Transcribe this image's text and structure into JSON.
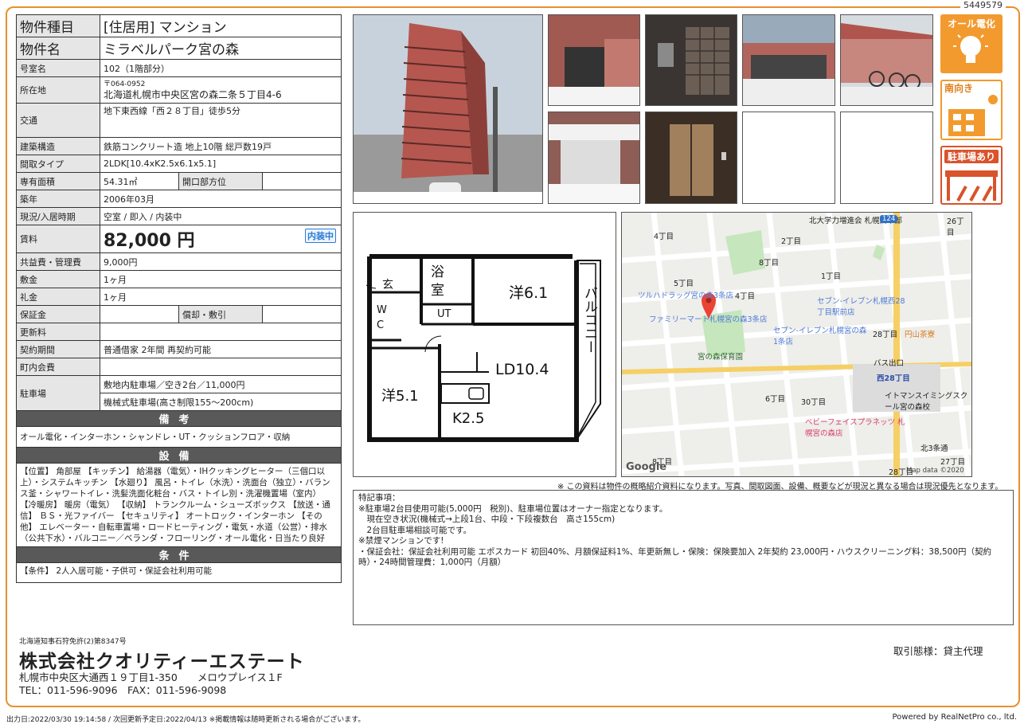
{
  "doc_id": "5449579",
  "spec": {
    "type_label": "物件種目",
    "type_value": "[住居用] マンション",
    "name_label": "物件名",
    "name_value": "ミラベルパーク宮の森",
    "room_label": "号室名",
    "room_value": "102（1階部分）",
    "addr_label": "所在地",
    "zip": "〒064-0952",
    "addr_value": "北海道札幌市中央区宮の森二条５丁目4-6",
    "access_label": "交通",
    "access_value": "地下東西線「西２８丁目」徒歩5分",
    "structure_label": "建築構造",
    "structure_value": "鉄筋コンクリート造 地上10階 総戸数19戸",
    "layout_label": "間取タイプ",
    "layout_value": "2LDK[10.4xK2.5x6.1x5.1]",
    "area_label": "専有面積",
    "area_value": "54.31㎡",
    "window_label": "開口部方位",
    "window_value": "",
    "built_label": "築年",
    "built_value": "2006年03月",
    "status_label": "現況/入居時期",
    "status_value": "空室 / 即入 / 内装中",
    "rent_label": "賃料",
    "rent_value": "82,000 円",
    "rent_badge": "内装中",
    "fee_label": "共益費・管理費",
    "fee_value": "9,000円",
    "deposit_label": "敷金",
    "deposit_value": "1ヶ月",
    "key_label": "礼金",
    "key_value": "1ヶ月",
    "guarantee_label": "保証金",
    "guarantee_value": "",
    "amort_label": "償却・敷引",
    "amort_value": "",
    "renew_label": "更新料",
    "renew_value": "",
    "contract_label": "契約期間",
    "contract_value": "普通借家 2年間 再契約可能",
    "town_label": "町内会費",
    "town_value": "",
    "parking_label": "駐車場",
    "parking_value1": "敷地内駐車場／空き2台／11,000円",
    "parking_value2": "機械式駐車場(高さ制限155～200cm)",
    "biko_head": "備考",
    "biko_text": "オール電化・インターホン・シャンドレ・UT・クッションフロア・収納",
    "setsubi_head": "設備",
    "setsubi_text": "【位置】 角部屋 【キッチン】 給湯器（電気）・IHクッキングヒーター（三個口以上）・システムキッチン 【水廻り】 風呂・トイレ（水洗）・洗面台（独立）・バランス釜・シャワートイレ・洗髪洗面化粧台・バス・トイレ別・洗濯機置場（室内） 【冷暖房】 暖房（電気） 【収納】 トランクルーム・シューズボックス 【放送・通信】 ＢＳ・光ファイバー 【セキュリティ】 オートロック・インターホン 【その他】 エレベーター・自転車置場・ロードヒーティング・電気・水道（公営）・排水（公共下水）・バルコニー／ベランダ・フローリング・オール電化・日当たり良好",
    "joken_head": "条件",
    "joken_text": "【条件】 2人入居可能・子供可・保証会社利用可能"
  },
  "icons": {
    "all_denka": "オール電化",
    "minami": "南向き",
    "parking": "駐車場あり"
  },
  "floorplan": {
    "genkan": "玄",
    "yoku": "浴",
    "shitsu": "室",
    "wc1": "W",
    "wc2": "C",
    "ut": "UT",
    "yo61": "洋6.1",
    "yo51": "洋5.1",
    "ld": "LD10.4",
    "k": "K2.5",
    "balcony": "バルコニー"
  },
  "map": {
    "labels": [
      "北大学力増進会 札幌西本部",
      "ツルハドラッグ宮の森3条店",
      "ファミリーマート札幌宮の森3条店",
      "宮の森保育園",
      "セブン-イレブン札幌西28丁目駅前店",
      "セブン-イレブン札幌宮の森1条店",
      "円山茶寮",
      "西28丁目",
      "イトマンスイミングスクール宮の森校",
      "ベビーフェイスプラネッツ 札幌宮の森店",
      "バス出口"
    ],
    "streets": [
      "4丁目",
      "2丁目",
      "8丁目",
      "5丁目",
      "4丁目",
      "1丁目",
      "26丁目",
      "28丁目",
      "30丁目",
      "6丁目",
      "8丁目",
      "28丁目",
      "27丁目",
      "北3条通"
    ],
    "google": "Google",
    "credit": "Map data ©2020",
    "route": "124"
  },
  "disclaimer": "※ この資料は物件の概略紹介資料になります。写真、間取図面、設備、概要などが現況と異なる場合は現況優先となります。",
  "notes": {
    "title": "特記事項：",
    "lines": [
      "※駐車場2台目使用可能(5,000円　税別)、駐車場位置はオーナー指定となります。",
      "　現在空き状況(機械式→上段1台、中段・下段複数台　高さ155cm)",
      "　2台目駐車場相談可能です。",
      "※禁煙マンションです!",
      "・保証会社：保証会社利用可能 エポスカード 初回40%、月額保証料1%、年更新無し・保険：保険要加入 2年契約 23,000円・ハウスクリーニング料：38,500円（契約時）・24時間管理費：1,000円（月額）"
    ]
  },
  "company": {
    "license": "北海道知事石狩免許(2)第8347号",
    "name": "株式会社クオリティーエステート",
    "address": "札幌市中央区大通西１９丁目1-350　　メロウプレイス１F",
    "tel": "TEL：011-596-9096　FAX：011-596-9098",
    "torihiki": "取引態様：貸主代理"
  },
  "footer": {
    "left": "出力日:2022/03/30 19:14:58 / 次回更新予定日:2022/04/13 ※掲載情報は随時更新される場合がございます。",
    "right": "Powered by RealNetPro co., ltd."
  }
}
